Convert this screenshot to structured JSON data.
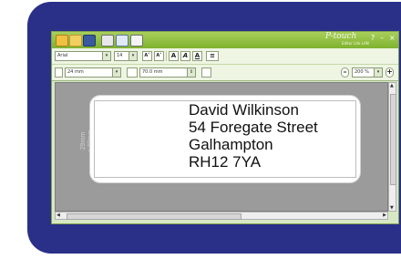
{
  "app": {
    "logo": "P-touch",
    "logo_sub": "Editor Lite LAN",
    "window_controls": [
      "?",
      "–",
      "×"
    ]
  },
  "toolbar_row1": {
    "font": "Arial",
    "font_size": "14",
    "format_buttons": [
      {
        "name": "increase-font-button",
        "glyph": "A˄"
      },
      {
        "name": "decrease-font-button",
        "glyph": "A˅"
      },
      {
        "name": "bold-button",
        "glyph": "A"
      },
      {
        "name": "italic-button",
        "glyph": "A"
      },
      {
        "name": "underline-button",
        "glyph": "A"
      },
      {
        "name": "align-button",
        "glyph": "≡"
      }
    ]
  },
  "toolbar_row2": {
    "tape_width": "24 mm",
    "tape_length": "70.0 mm",
    "zoom": "200 %"
  },
  "label": {
    "lines": [
      "David Wilkinson",
      "54 Foregate Street",
      "Galhampton",
      "RH12 7YA"
    ],
    "dimension_line1": "29mm",
    "dimension_line2": "x 90mm"
  },
  "colors": {
    "panel": "#2a2f88",
    "titlebar": "#8cc23a",
    "canvas": "#9b9b9b"
  }
}
